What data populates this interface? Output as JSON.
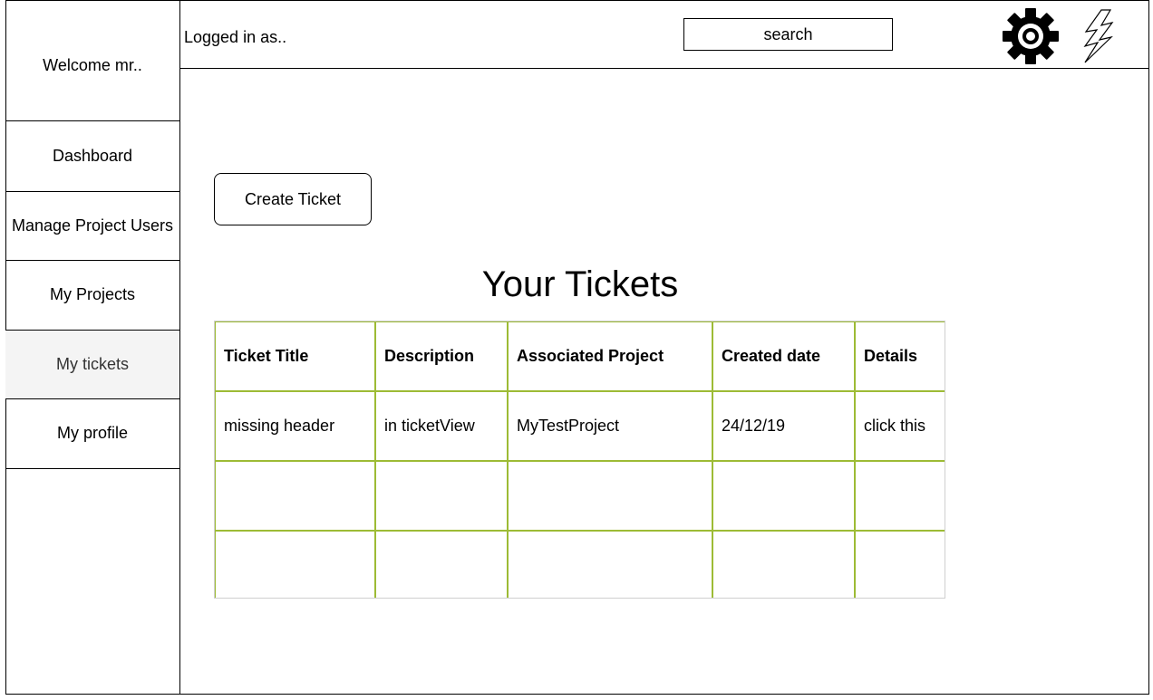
{
  "sidebar": {
    "welcome": "Welcome mr..",
    "items": [
      {
        "label": "Dashboard",
        "active": false
      },
      {
        "label": "Manage Project Users",
        "active": false
      },
      {
        "label": "My Projects",
        "active": false
      },
      {
        "label": "My tickets",
        "active": true
      },
      {
        "label": "My profile",
        "active": false
      }
    ]
  },
  "header": {
    "logged_in": "Logged in as..",
    "search_placeholder": "search",
    "icons": [
      "gear-icon",
      "lightning-icon"
    ]
  },
  "main": {
    "create_button": "Create Ticket",
    "title": "Your Tickets",
    "table": {
      "columns": [
        "Ticket Title",
        "Description",
        "Associated Project",
        "Created date",
        "Details"
      ],
      "rows": [
        [
          "missing header",
          "in ticketView",
          "MyTestProject",
          "24/12/19",
          "click this"
        ],
        [
          "",
          "",
          "",
          "",
          ""
        ],
        [
          "",
          "",
          "",
          "",
          ""
        ]
      ]
    }
  },
  "colors": {
    "table_border": "#9dbb35",
    "active_nav_bg": "#f4f4f4"
  }
}
